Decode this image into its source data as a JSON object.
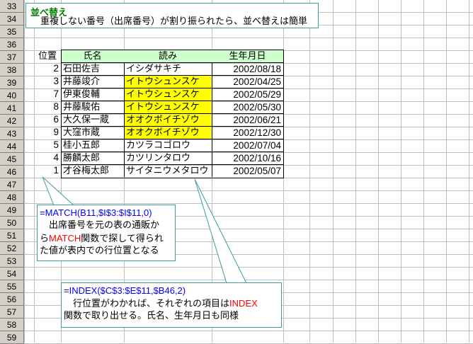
{
  "row_numbers": [
    "33",
    "34",
    "35",
    "36",
    "37",
    "38",
    "39",
    "40",
    "41",
    "42",
    "43",
    "44",
    "45",
    "46",
    "47",
    "48",
    "49",
    "50",
    "51",
    "52",
    "53",
    "54",
    "55",
    "56",
    "57",
    "58",
    "59"
  ],
  "title_box": {
    "title": "並べ替え",
    "text": "重複しない番号（出席番号）が割り振られたら、並べ替えは簡単"
  },
  "table": {
    "position_header": "位置",
    "headers": [
      "氏名",
      "読み",
      "生年月日"
    ],
    "rows": [
      {
        "pos": "2",
        "name": "石田佐吉",
        "reading": "イシダサキチ",
        "dob": "2002/08/18",
        "hl": false
      },
      {
        "pos": "3",
        "name": "井藤竣介",
        "reading": "イトウシュンスケ",
        "dob": "2002/04/25",
        "hl": true
      },
      {
        "pos": "7",
        "name": "伊東俊輔",
        "reading": "イトウシュンスケ",
        "dob": "2002/05/29",
        "hl": true
      },
      {
        "pos": "8",
        "name": "井藤駿佑",
        "reading": "イトウシュンスケ",
        "dob": "2002/05/30",
        "hl": true
      },
      {
        "pos": "6",
        "name": "大久保一蔵",
        "reading": "オオクボイチゾウ",
        "dob": "2002/06/21",
        "hl": true
      },
      {
        "pos": "9",
        "name": "大窪市蔵",
        "reading": "オオクボイチゾウ",
        "dob": "2002/12/30",
        "hl": true
      },
      {
        "pos": "5",
        "name": "桂小五郎",
        "reading": "カツラコゴロウ",
        "dob": "2002/07/04",
        "hl": false
      },
      {
        "pos": "4",
        "name": "勝麟太郎",
        "reading": "カツリンタロウ",
        "dob": "2002/10/16",
        "hl": false
      },
      {
        "pos": "1",
        "name": "才谷梅太郎",
        "reading": "サイタニウメタロウ",
        "dob": "2002/05/07",
        "hl": false
      }
    ]
  },
  "callout_match": {
    "formula": "=MATCH(B11,$I$3:$I$11,0)",
    "line1": "出席番号を元の表の通販か",
    "line2_pre": "ら",
    "line2_red": "MATCH",
    "line2_post": "関数で探して得られ",
    "line3": "た値が表内での行位置となる"
  },
  "callout_index": {
    "formula": "=INDEX($C$3:$E$11,$B46,2)",
    "line1_pre": "行位置がわかれば、それぞれの項目は",
    "line1_red": "INDEX",
    "line2": "関数で取り出せる。氏名、生年月日も同様"
  },
  "colors": {
    "header_green": "#ccffcc",
    "highlight_yellow": "#ffff00",
    "title_green": "#008000",
    "formula_blue": "#0000ff",
    "keyword_red": "#ff0000",
    "callout_border": "#3c9ca0"
  }
}
